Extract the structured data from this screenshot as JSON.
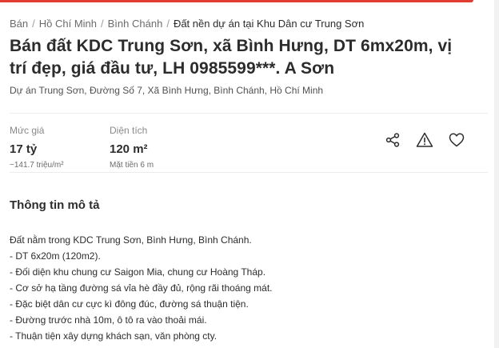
{
  "breadcrumb": {
    "items": [
      "Bán",
      "Hồ Chí Minh",
      "Bình Chánh"
    ],
    "current": "Đất nền dự án tại Khu Dân cư Trung Sơn"
  },
  "listing": {
    "title": "Bán đất KDC Trung Sơn, xã Bình Hưng, DT 6mx20m, vị trí đẹp, giá đầu tư, LH 0985599***. A Sơn",
    "address": "Dự án Trung Sơn, Đường Số 7, Xã Bình Hưng, Bình Chánh, Hồ Chí Minh"
  },
  "stats": {
    "price": {
      "label": "Mức giá",
      "value": "17 tỷ",
      "sub": "~141.7 triệu/m²"
    },
    "area": {
      "label": "Diện tích",
      "value": "120 m²",
      "sub": "Mặt tiền 6 m"
    }
  },
  "actions": {
    "icons": [
      "share-icon",
      "warning-icon",
      "heart-icon"
    ]
  },
  "description": {
    "heading": "Thông tin mô tả",
    "lines": [
      "Đất nằm trong KDC Trung Sơn, Bình Hưng, Bình Chánh.",
      "- DT 6x20m (120m2).",
      "- Đối diện khu chung cư Saigon Mia, chung cư Hoàng Tháp.",
      "- Cơ sở hạ tầng đường sá vỉa hè đầy đủ, rộng rãi thoáng mát.",
      "- Đặc biệt dân cư cực kì đông đúc, đường sá thuận tiện.",
      "- Đường trước nhà 10m, ô tô ra vào thoải mái.",
      "- Thuận tiện xây dựng khách sạn, văn phòng cty."
    ]
  },
  "colors": {
    "accent": "#e03c31",
    "text": "#2c2c2c",
    "muted": "#8a8a8a"
  }
}
